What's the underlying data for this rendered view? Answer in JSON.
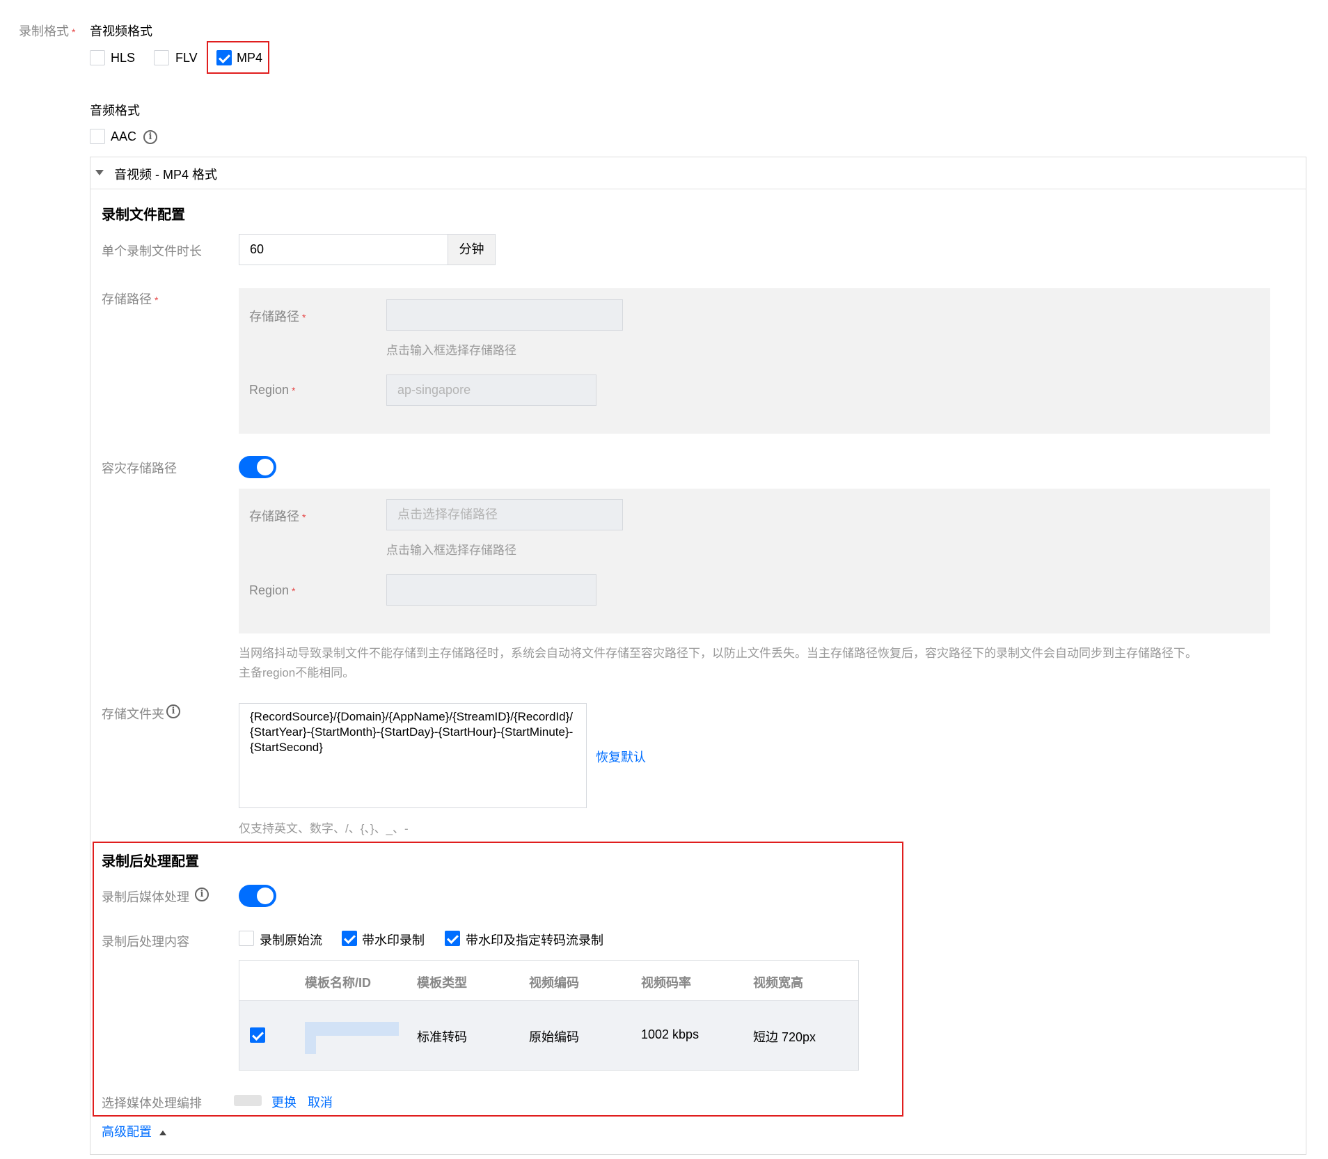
{
  "record_format": {
    "label": "录制格式",
    "av_format_title": "音视频格式",
    "av_options": [
      {
        "label": "HLS",
        "checked": false
      },
      {
        "label": "FLV",
        "checked": false
      },
      {
        "label": "MP4",
        "checked": true
      }
    ],
    "audio_format_title": "音频格式",
    "audio_options": [
      {
        "label": "AAC",
        "checked": false
      }
    ]
  },
  "panel": {
    "header": "音视频 - MP4 格式",
    "record_file_config": {
      "title": "录制文件配置",
      "duration_label": "单个录制文件时长",
      "duration_value": "60",
      "duration_unit": "分钟",
      "storage_path_label": "存储路径",
      "storage": {
        "path_label": "存储路径",
        "path_value": "",
        "path_hint": "点击输入框选择存储路径",
        "region_label": "Region",
        "region_value": "ap-singapore"
      },
      "dr_label": "容灾存储路径",
      "dr_enabled": true,
      "dr_storage": {
        "path_label": "存储路径",
        "path_placeholder": "点击选择存储路径",
        "path_hint": "点击输入框选择存储路径",
        "region_label": "Region",
        "region_value": ""
      },
      "dr_description_line1": "当网络抖动导致录制文件不能存储到主存储路径时，系统会自动将文件存储至容灾路径下，以防止文件丢失。当主存储路径恢复后，容灾路径下的录制文件会自动同步到主存储路径下。",
      "dr_description_line2": "主备region不能相同。",
      "folder_label": "存储文件夹",
      "folder_value": "{RecordSource}/{Domain}/{AppName}/{StreamID}/{RecordId}/{StartYear}-{StartMonth}-{StartDay}-{StartHour}-{StartMinute}-{StartSecond}",
      "restore_default": "恢复默认",
      "folder_hint": "仅支持英文、数字、/、{、}、_、-"
    },
    "post_processing": {
      "title": "录制后处理配置",
      "media_processing_label": "录制后媒体处理",
      "media_processing_enabled": true,
      "content_label": "录制后处理内容",
      "content_options": [
        {
          "label": "录制原始流",
          "checked": false
        },
        {
          "label": "带水印录制",
          "checked": true
        },
        {
          "label": "带水印及指定转码流录制",
          "checked": true
        }
      ],
      "table": {
        "columns": [
          "模板名称/ID",
          "模板类型",
          "视频编码",
          "视频码率",
          "视频宽高"
        ],
        "rows": [
          {
            "checked": true,
            "name": "",
            "type": "标准转码",
            "codec": "原始编码",
            "bitrate": "1002 kbps",
            "resolution": "短边 720px"
          }
        ]
      },
      "orchestration_label": "选择媒体处理编排",
      "change_link": "更换",
      "cancel_link": "取消"
    },
    "advanced_link": "高级配置"
  },
  "colors": {
    "accent": "#006eff",
    "highlight_box": "#e01e1e",
    "required": "#e54545"
  }
}
